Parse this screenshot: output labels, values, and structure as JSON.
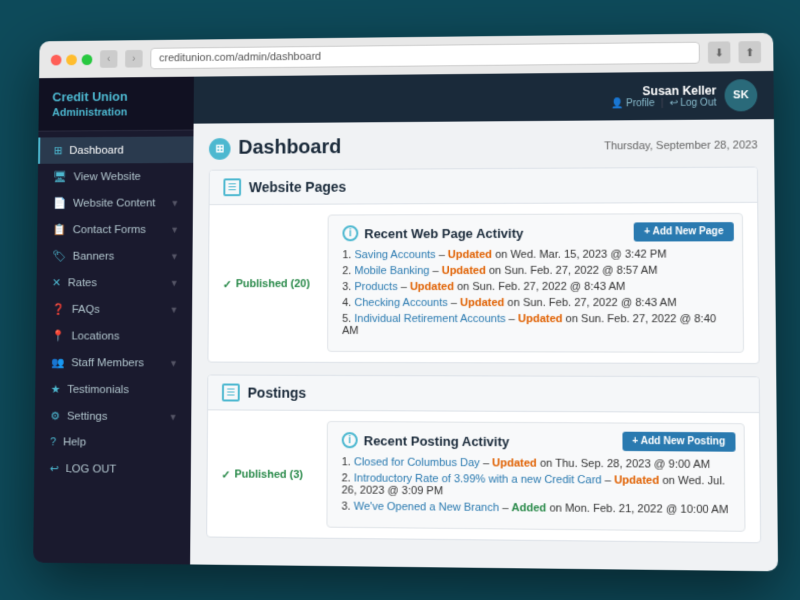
{
  "browser": {
    "url": "creditunion.com/admin/dashboard",
    "traffic_lights": [
      "red",
      "yellow",
      "green"
    ]
  },
  "sidebar": {
    "logo_text": "Credit Union",
    "logo_subtext": "Administration",
    "items": [
      {
        "id": "dashboard",
        "label": "Dashboard",
        "icon": "⊞",
        "active": true,
        "has_arrow": false
      },
      {
        "id": "view-website",
        "label": "View Website",
        "icon": "🖥",
        "active": false,
        "has_arrow": false
      },
      {
        "id": "website-content",
        "label": "Website Content",
        "icon": "📄",
        "active": false,
        "has_arrow": true
      },
      {
        "id": "contact-forms",
        "label": "Contact Forms",
        "icon": "📋",
        "active": false,
        "has_arrow": true
      },
      {
        "id": "banners",
        "label": "Banners",
        "icon": "🏷",
        "active": false,
        "has_arrow": true
      },
      {
        "id": "rates",
        "label": "Rates",
        "icon": "✕",
        "active": false,
        "has_arrow": true
      },
      {
        "id": "faqs",
        "label": "FAQs",
        "icon": "❓",
        "active": false,
        "has_arrow": true
      },
      {
        "id": "locations",
        "label": "Locations",
        "icon": "📍",
        "active": false,
        "has_arrow": false
      },
      {
        "id": "staff-members",
        "label": "Staff Members",
        "icon": "👥",
        "active": false,
        "has_arrow": true
      },
      {
        "id": "testimonials",
        "label": "Testimonials",
        "icon": "★",
        "active": false,
        "has_arrow": false
      },
      {
        "id": "settings",
        "label": "Settings",
        "icon": "⚙",
        "active": false,
        "has_arrow": true
      },
      {
        "id": "help",
        "label": "Help",
        "icon": "?",
        "active": false,
        "has_arrow": false
      },
      {
        "id": "logout",
        "label": "LOG OUT",
        "icon": "↩",
        "active": false,
        "has_arrow": false
      }
    ]
  },
  "header": {
    "user_initials": "SK",
    "user_name": "Susan Keller",
    "profile_label": "Profile",
    "logout_label": "Log Out"
  },
  "main": {
    "page_title": "Dashboard",
    "page_date": "Thursday, September 28, 2023",
    "sections": [
      {
        "id": "website-pages",
        "title": "Website Pages",
        "icon": "☰",
        "published_count": 20,
        "published_label": "Published (20)",
        "activity_title": "Recent Web Page Activity",
        "add_btn_label": "+ Add New Page",
        "items": [
          {
            "num": 1,
            "link_text": "Saving Accounts",
            "action": "Updated",
            "date_text": "on Wed. Mar. 15, 2023 @ 3:42 PM",
            "action_type": "update"
          },
          {
            "num": 2,
            "link_text": "Mobile Banking",
            "action": "Updated",
            "date_text": "on Sun. Feb. 27, 2022 @ 8:57 AM",
            "action_type": "update"
          },
          {
            "num": 3,
            "link_text": "Products",
            "action": "Updated",
            "date_text": "on Sun. Feb. 27, 2022 @ 8:43 AM",
            "action_type": "update"
          },
          {
            "num": 4,
            "link_text": "Checking Accounts",
            "action": "Updated",
            "date_text": "on Sun. Feb. 27, 2022 @ 8:43 AM",
            "action_type": "update"
          },
          {
            "num": 5,
            "link_text": "Individual Retirement Accounts",
            "action": "Updated",
            "date_text": "on Sun. Feb. 27, 2022 @ 8:40 AM",
            "action_type": "update"
          }
        ]
      },
      {
        "id": "postings",
        "title": "Postings",
        "icon": "☰",
        "published_count": 3,
        "published_label": "Published (3)",
        "activity_title": "Recent Posting Activity",
        "add_btn_label": "+ Add New Posting",
        "items": [
          {
            "num": 1,
            "link_text": "Closed for Columbus Day",
            "action": "Updated",
            "date_text": "on Thu. Sep. 28, 2023 @ 9:00 AM",
            "action_type": "update"
          },
          {
            "num": 2,
            "link_text": "Introductory Rate of 3.99% with a new Credit Card",
            "action": "Updated",
            "date_text": "on Wed. Jul. 26, 2023 @ 3:09 PM",
            "action_type": "update"
          },
          {
            "num": 3,
            "link_text": "We've Opened a New Branch",
            "action": "Added",
            "date_text": "on Mon. Feb. 21, 2022 @ 10:00 AM",
            "action_type": "add"
          }
        ]
      }
    ]
  }
}
